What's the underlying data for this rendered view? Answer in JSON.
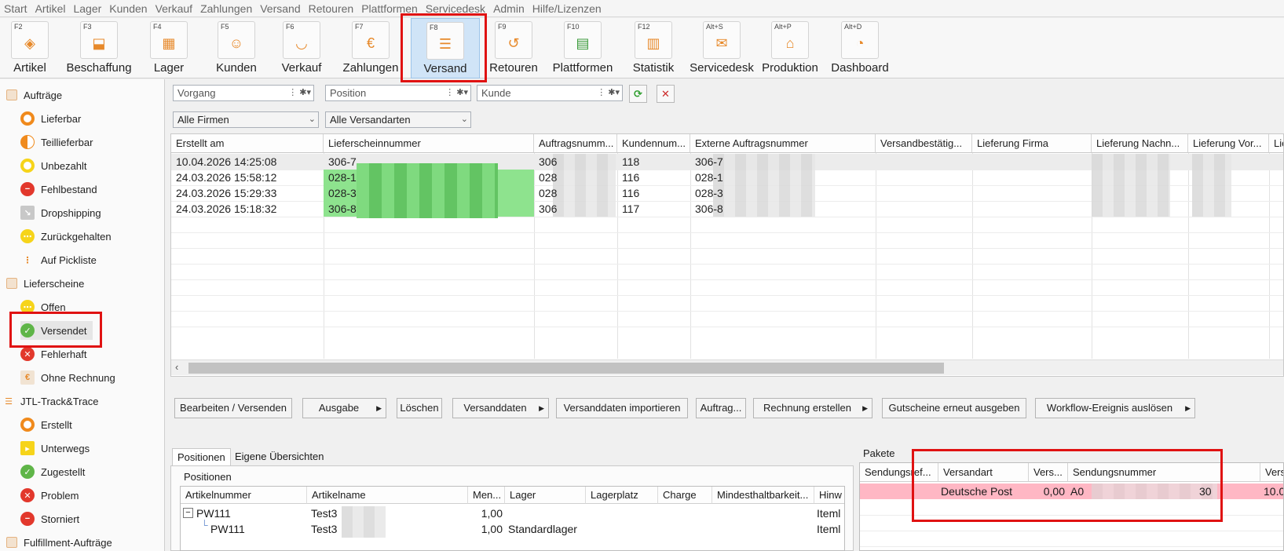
{
  "menu": [
    "Start",
    "Artikel",
    "Lager",
    "Kunden",
    "Verkauf",
    "Zahlungen",
    "Versand",
    "Retouren",
    "Plattformen",
    "Servicedesk",
    "Admin",
    "Hilfe/Lizenzen"
  ],
  "toolbar": [
    {
      "key": "F2",
      "label": "Artikel",
      "icon": "tag-icon"
    },
    {
      "key": "F3",
      "label": "Beschaffung",
      "icon": "box-in-icon"
    },
    {
      "key": "F4",
      "label": "Lager",
      "icon": "warehouse-icon"
    },
    {
      "key": "F5",
      "label": "Kunden",
      "icon": "customer-icon"
    },
    {
      "key": "F6",
      "label": "Verkauf",
      "icon": "cart-icon"
    },
    {
      "key": "F7",
      "label": "Zahlungen",
      "icon": "euro-icon"
    },
    {
      "key": "F8",
      "label": "Versand",
      "icon": "shipping-icon",
      "active": true
    },
    {
      "key": "F9",
      "label": "Retouren",
      "icon": "return-icon"
    },
    {
      "key": "F10",
      "label": "Plattformen",
      "icon": "store-icon"
    },
    {
      "key": "F12",
      "label": "Statistik",
      "icon": "chart-icon"
    },
    {
      "key": "Alt+S",
      "label": "Servicedesk",
      "icon": "ticket-icon"
    },
    {
      "key": "Alt+P",
      "label": "Produktion",
      "icon": "factory-icon"
    },
    {
      "key": "Alt+D",
      "label": "Dashboard",
      "icon": "gauge-icon"
    }
  ],
  "sidebar": {
    "groups": [
      {
        "label": "Aufträge",
        "items": [
          "Lieferbar",
          "Teillieferbar",
          "Unbezahlt",
          "Fehlbestand",
          "Dropshipping",
          "Zurückgehalten",
          "Auf Pickliste"
        ]
      },
      {
        "label": "Lieferscheine",
        "items": [
          "Offen",
          "Versendet",
          "Fehlerhaft",
          "Ohne Rechnung"
        ]
      },
      {
        "label": "JTL-Track&Trace",
        "items": [
          "Erstellt",
          "Unterwegs",
          "Zugestellt",
          "Problem",
          "Storniert"
        ]
      },
      {
        "label": "Fulfillment-Aufträge",
        "items": []
      }
    ],
    "selected": "Versendet"
  },
  "filters": {
    "vorgang_placeholder": "Vorgang",
    "position_placeholder": "Position",
    "kunde_placeholder": "Kunde",
    "firma": "Alle Firmen",
    "versandart": "Alle Versandarten"
  },
  "grid": {
    "columns": [
      "Erstellt am",
      "Lieferscheinnummer",
      "Auftragsnumm...",
      "Kundennum...",
      "Externe Auftragsnummer",
      "Versandbestätig...",
      "Lieferung Firma",
      "Lieferung Nachn...",
      "Lieferung Vor...",
      "Lie"
    ],
    "rows": [
      {
        "erstellt": "10.04.2026 14:25:08",
        "lieferschein": "306-7",
        "auftrag": "306",
        "kunde": "118",
        "extern": "306-7"
      },
      {
        "erstellt": "24.03.2026 15:58:12",
        "lieferschein": "028-1",
        "auftrag": "028",
        "kunde": "116",
        "extern": "028-1"
      },
      {
        "erstellt": "24.03.2026 15:29:33",
        "lieferschein": "028-3",
        "auftrag": "028",
        "kunde": "116",
        "extern": "028-3"
      },
      {
        "erstellt": "24.03.2026 15:18:32",
        "lieferschein": "306-8",
        "auftrag": "306",
        "kunde": "117",
        "extern": "306-8"
      }
    ]
  },
  "actions": [
    "Bearbeiten / Versenden",
    "Ausgabe",
    "Löschen",
    "Versanddaten",
    "Versanddaten importieren",
    "Auftrag...",
    "Rechnung erstellen",
    "Gutscheine erneut ausgeben",
    "Workflow-Ereignis auslösen"
  ],
  "bottom_tabs": [
    "Positionen",
    "Eigene Übersichten"
  ],
  "positions": {
    "title": "Positionen",
    "columns": [
      "Artikelnummer",
      "Artikelname",
      "Men...",
      "Lager",
      "Lagerplatz",
      "Charge",
      "Mindesthaltbarkeit...",
      "Hinw"
    ],
    "rows": [
      {
        "nr": "PW111",
        "name": "Test3",
        "menge": "1,00",
        "lager": "",
        "hinweis": "Iteml"
      },
      {
        "nr": "PW111",
        "name": "Test3",
        "menge": "1,00",
        "lager": "Standardlager",
        "hinweis": "Iteml"
      }
    ]
  },
  "pakete": {
    "title": "Pakete",
    "columns": [
      "Sendungsref...",
      "Versandart",
      "Vers...",
      "Sendungsnummer",
      "Vers"
    ],
    "row": {
      "ref": "",
      "versandart": "Deutsche Post",
      "kosten": "0,00",
      "nummer_prefix": "A0",
      "nummer_suffix": "30",
      "vers": "10.0"
    }
  },
  "colors": {
    "accent_orange": "#e7892a",
    "highlight_red": "#e01212",
    "row_pink": "#ffb7c4",
    "green_cell": "#8ee38e"
  }
}
